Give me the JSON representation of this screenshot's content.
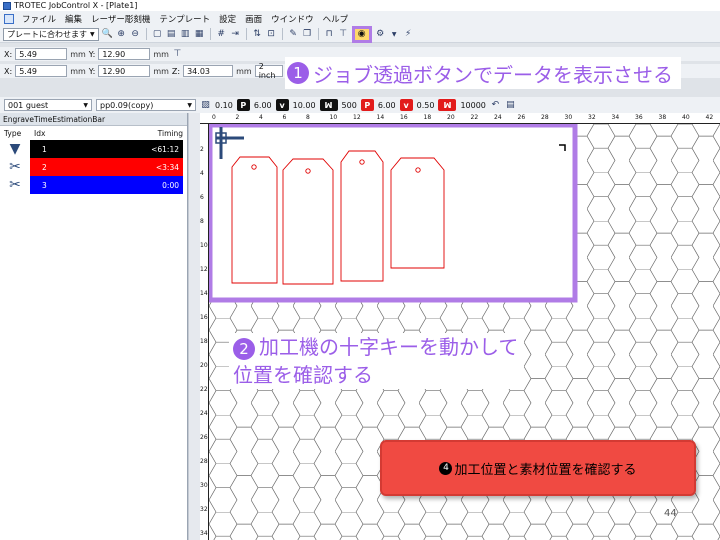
{
  "window": {
    "title": "TROTEC JobControl X - [Plate1]"
  },
  "menu": {
    "items": [
      "ファイル",
      "編集",
      "レーザー彫刻機",
      "テンプレート",
      "設定",
      "画面",
      "ウインドウ",
      "ヘルプ"
    ]
  },
  "toolbar": {
    "fit_dropdown": "プレートに合わせます"
  },
  "coords": {
    "row1": {
      "x_label": "X:",
      "x": "5.49",
      "x_unit": "mm",
      "y_label": "Y:",
      "y": "12.90",
      "y_unit": "mm"
    },
    "row2": {
      "x_label": "X:",
      "x": "5.49",
      "x_unit": "mm",
      "y_label": "Y:",
      "y": "12.90",
      "y_unit": "mm",
      "z_label": "Z:",
      "z": "34.03",
      "z_unit": "mm",
      "lens": "2 inch"
    }
  },
  "params": {
    "user": "001 guest",
    "material": "pp0.09(copy)",
    "v1": "0.10",
    "p_engrave": "6.00",
    "v_engrave": "10.00",
    "ppi": "500",
    "p_cut": "6.00",
    "v_cut": "0.50",
    "hz": "10000",
    "p_chip": "P",
    "v_chip": "v"
  },
  "panel": {
    "title": "EngraveTimeEstimationBar",
    "col_type": "Type",
    "col_idx": "Idx",
    "col_timing": "Timing",
    "rows": [
      {
        "idx": "1",
        "timing": "<61:12",
        "color": "#000000",
        "icon": "engrave-icon"
      },
      {
        "idx": "2",
        "timing": "<3:34",
        "color": "#ff0000",
        "icon": "cut-icon"
      },
      {
        "idx": "3",
        "timing": "0:00",
        "color": "#0000ff",
        "icon": "cut-icon"
      }
    ]
  },
  "rulers": {
    "top": [
      "0",
      "2",
      "4",
      "6",
      "8",
      "10",
      "12",
      "14",
      "16",
      "18",
      "20",
      "22",
      "24",
      "26",
      "28",
      "30",
      "32",
      "34",
      "36",
      "38",
      "40",
      "42"
    ],
    "left": [
      "2",
      "4",
      "6",
      "8",
      "10",
      "12",
      "14",
      "16",
      "18",
      "20",
      "22",
      "24",
      "26",
      "28",
      "30",
      "32",
      "34"
    ]
  },
  "annotations": {
    "c1_num": "1",
    "c1_text": "ジョブ透過ボタンでデータを表示させる",
    "c2_num": "2",
    "c2_line1": "加工機の十字キーを動かして",
    "c2_line2": "位置を確認する",
    "c4_num": "4",
    "c4_text": "加工位置と素材位置を確認する"
  },
  "colors": {
    "accent": "#9b5ee8",
    "highlight_box": "#b07ce6",
    "cut_line": "#e00000",
    "callout4_bg": "#f04a42"
  },
  "page_number": "44"
}
